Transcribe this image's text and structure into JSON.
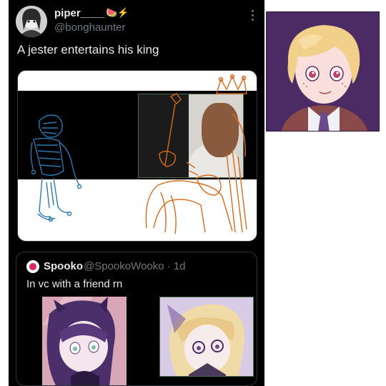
{
  "tweet": {
    "display_name": "piper____",
    "name_emoji": "🍉⚡",
    "handle": "@bonghaunter",
    "text": "A jester entertains his king"
  },
  "quoted": {
    "name": "Spooko",
    "handle_time": "@SpookoWooko · 1d",
    "text": "In vc with a friend rn"
  },
  "icons": {
    "more": "more-vertical-icon"
  },
  "colors": {
    "background": "#000000",
    "text_primary": "#e7e9ea",
    "text_secondary": "#71767b",
    "border": "#2f3336",
    "jester_line": "#2a7ab0",
    "king_line": "#d96a1a",
    "portrait_bg": "#4c2a64"
  }
}
